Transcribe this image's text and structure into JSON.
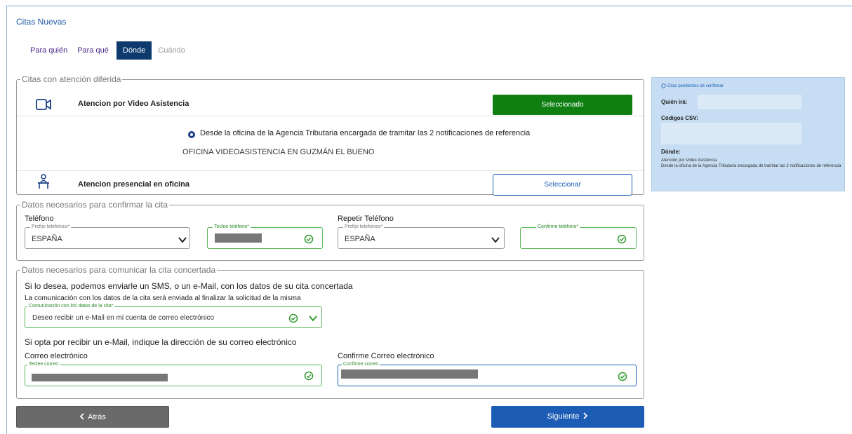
{
  "header": {
    "title": "Citas Nuevas"
  },
  "steps": {
    "para_quien": "Para quién",
    "para_que": "Para qué",
    "donde": "Dónde",
    "cuando": "Cuándo"
  },
  "deferred": {
    "legend": "Citas con atención diferida",
    "video": {
      "title": "Atencion por Video Asistencia",
      "button": "Seleccionado",
      "radio_label": "Desde la oficina de la Agencia Tributaria encargada de tramitar las 2 notificaciones de referencia",
      "office": "OFICINA VIDEOASISTENCIA EN GUZMÁN EL BUENO"
    },
    "presencial": {
      "title": "Atencion presencial en oficina",
      "button": "Seleccionar"
    }
  },
  "confirm": {
    "legend": "Datos necesarios para confirmar la cita",
    "phone_label": "Teléfono",
    "repeat_phone_label": "Repetir Teléfono",
    "prefix_label": "Prefijo telefónico*",
    "prefix_value": "ESPAÑA",
    "phone_field_label": "Teclee teléfono*",
    "repeat_prefix_label": "Prefijo telefónico*",
    "repeat_prefix_value": "ESPAÑA",
    "confirm_phone_label": "Confirme teléfono*"
  },
  "communicate": {
    "legend": "Datos necesarios para comunicar la cita concertada",
    "line1": "Si lo desea, podemos enviarle un SMS, o un e-Mail, con los datos de su cita concertada",
    "line2": "La comunicación con los datos de la cita será enviada al finalizar la solicitud de la misma",
    "channel_label": "Comunicación con los datos de la cita*",
    "channel_value": "Deseo recibir un e-Mail en mi cuenta de correo electrónico",
    "email_hint": "Si opta por recibir un e-Mail, indique la dirección de su correo electrónico",
    "email_label": "Correo electrónico",
    "email_field_label": "Teclee correo",
    "confirm_email_label": "Confirme Correo electrónico",
    "confirm_email_field_label": "Confirme correo"
  },
  "sidebar": {
    "heading": "Citas pendientes de confirmar",
    "quien": "Quién irá:",
    "csv": "Códigos CSV:",
    "donde": "Dónde:",
    "donde_line1": "Atención por Video Asistencia",
    "donde_line2": "Desde la oficina de la Agencia Tributaria encargada de tramitar las 2 notificaciones de referencia"
  },
  "nav": {
    "back": "Atrás",
    "next": "Siguiente"
  },
  "colors": {
    "accent": "#1c5cb5",
    "selected": "#0f7f12",
    "sidebar_bg": "#c6ddf3",
    "active_step": "#0e3a6e"
  },
  "icons": [
    "video-icon",
    "person-desk-icon",
    "check-circle-icon",
    "chevron-down-icon",
    "chevron-left-icon",
    "chevron-right-icon",
    "info-icon"
  ]
}
